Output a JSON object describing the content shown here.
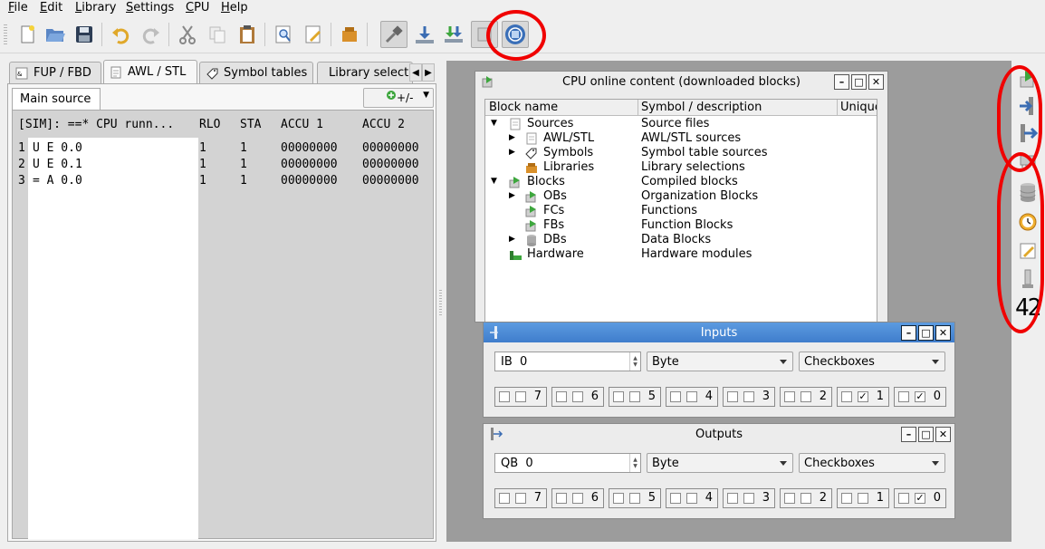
{
  "menu": [
    {
      "label": "File",
      "accel": "F",
      "rest": "ile"
    },
    {
      "label": "Edit",
      "accel": "E",
      "rest": "dit"
    },
    {
      "label": "Library",
      "accel": "L",
      "rest": "ibrary"
    },
    {
      "label": "Settings",
      "accel": "S",
      "rest": "ettings"
    },
    {
      "label": "CPU",
      "accel": "C",
      "rest": "PU"
    },
    {
      "label": "Help",
      "accel": "H",
      "rest": "elp"
    }
  ],
  "toolbar_icons": [
    "new-icon",
    "open-icon",
    "save-icon",
    "undo-icon",
    "redo-icon",
    "cut-icon",
    "copy-icon",
    "paste-icon",
    "find-icon",
    "edit-icon",
    "library-icon",
    "connect-icon",
    "download-icon",
    "download-all-icon",
    "window-icon",
    "cpu-online-icon"
  ],
  "tabs": {
    "fup": "FUP / FBD",
    "awl": "AWL / STL",
    "symbols": "Symbol tables",
    "library": "Library selections"
  },
  "editor": {
    "subtab": "Main source",
    "add_button": "+/-",
    "header": {
      "status": "[SIM]: ==* CPU runn...",
      "rlo": "RLO",
      "sta": "STA",
      "accu1": "ACCU 1",
      "accu2": "ACCU 2"
    },
    "lines": [
      {
        "num": "1",
        "code": "U E 0.0",
        "rlo": "1",
        "sta": "1",
        "accu1": "00000000",
        "accu2": "00000000"
      },
      {
        "num": "2",
        "code": "U E 0.1",
        "rlo": "1",
        "sta": "1",
        "accu1": "00000000",
        "accu2": "00000000"
      },
      {
        "num": "3",
        "code": "= A 0.0",
        "rlo": "1",
        "sta": "1",
        "accu1": "00000000",
        "accu2": "00000000"
      }
    ]
  },
  "cpu_window": {
    "title": "CPU online content (downloaded blocks)",
    "columns": [
      "Block name",
      "Symbol / description",
      "Unique"
    ],
    "rows": [
      {
        "name": "Sources",
        "desc": "Source files",
        "level": 0,
        "arrow": "down",
        "icon": "document-icon"
      },
      {
        "name": "AWL/STL",
        "desc": "AWL/STL sources",
        "level": 1,
        "arrow": "right",
        "icon": "document-icon"
      },
      {
        "name": "Symbols",
        "desc": "Symbol table sources",
        "level": 1,
        "arrow": "right",
        "icon": "tag-icon"
      },
      {
        "name": "Libraries",
        "desc": "Library selections",
        "level": 1,
        "arrow": "",
        "icon": "library-icon"
      },
      {
        "name": "Blocks",
        "desc": "Compiled blocks",
        "level": 0,
        "arrow": "down",
        "icon": "block-icon"
      },
      {
        "name": "OBs",
        "desc": "Organization Blocks",
        "level": 1,
        "arrow": "right",
        "icon": "block-icon"
      },
      {
        "name": "FCs",
        "desc": "Functions",
        "level": 1,
        "arrow": "",
        "icon": "block-icon"
      },
      {
        "name": "FBs",
        "desc": "Function Blocks",
        "level": 1,
        "arrow": "",
        "icon": "block-icon"
      },
      {
        "name": "DBs",
        "desc": "Data Blocks",
        "level": 1,
        "arrow": "right",
        "icon": "database-icon"
      },
      {
        "name": "Hardware",
        "desc": "Hardware modules",
        "level": 0,
        "arrow": "",
        "icon": "hardware-icon"
      }
    ]
  },
  "inputs_window": {
    "title": "Inputs",
    "address": "IB  0",
    "type": "Byte",
    "display": "Checkboxes",
    "bits": [
      {
        "num": "7",
        "checked": false
      },
      {
        "num": "6",
        "checked": false
      },
      {
        "num": "5",
        "checked": false
      },
      {
        "num": "4",
        "checked": false
      },
      {
        "num": "3",
        "checked": false
      },
      {
        "num": "2",
        "checked": false
      },
      {
        "num": "1",
        "checked": true
      },
      {
        "num": "0",
        "checked": true
      }
    ]
  },
  "outputs_window": {
    "title": "Outputs",
    "address": "QB  0",
    "type": "Byte",
    "display": "Checkboxes",
    "bits": [
      {
        "num": "7",
        "checked": false
      },
      {
        "num": "6",
        "checked": false
      },
      {
        "num": "5",
        "checked": false
      },
      {
        "num": "4",
        "checked": false
      },
      {
        "num": "3",
        "checked": false
      },
      {
        "num": "2",
        "checked": false
      },
      {
        "num": "1",
        "checked": false
      },
      {
        "num": "0",
        "checked": true
      }
    ]
  },
  "right_toolbar": {
    "icons": [
      "cpu-blocks-icon",
      "inputs-icon",
      "outputs-icon",
      "memory-icon",
      "database-icon",
      "timer-icon",
      "counter-icon",
      "lamp-icon"
    ],
    "counter_label": "42"
  },
  "colors": {
    "annotation": "#f00000",
    "active_title": "#3f7dcc",
    "mdi_background": "#9c9c9c"
  }
}
